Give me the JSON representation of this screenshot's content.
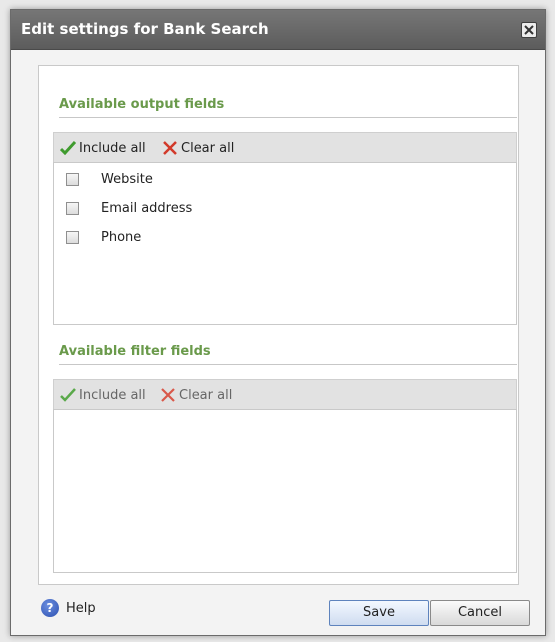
{
  "dialog": {
    "title": "Edit settings for Bank Search",
    "close_icon": "close-icon"
  },
  "output_section": {
    "title": "Available output fields",
    "include_all": "Include all",
    "clear_all": "Clear all",
    "fields": [
      "Website",
      "Email address",
      "Phone"
    ]
  },
  "filter_section": {
    "title": "Available filter fields",
    "include_all": "Include all",
    "clear_all": "Clear all",
    "fields": []
  },
  "footer": {
    "help": "Help",
    "save": "Save",
    "cancel": "Cancel"
  },
  "colors": {
    "section_title": "#6a9a4b",
    "check_green": "#3f9b2e",
    "clear_red": "#d23a2a"
  }
}
